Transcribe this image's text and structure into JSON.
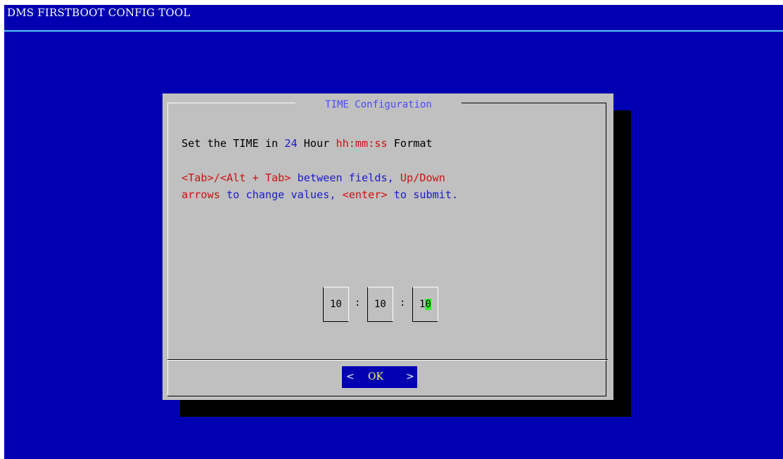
{
  "app": {
    "title": "DMS FIRSTBOOT CONFIG TOOL"
  },
  "dialog": {
    "title": "TIME Configuration",
    "instructions": {
      "line1": [
        "Set the TIME in ",
        "24",
        " Hour ",
        "hh:mm:ss",
        " Format"
      ],
      "line2": [
        "<Tab>/<Alt + Tab>",
        " between fields, ",
        "Up/Down"
      ],
      "line3": [
        "arrows",
        " to change values, ",
        "<enter>",
        " to submit."
      ]
    },
    "time": {
      "hours": "10",
      "minutes": "10",
      "seconds_prefix": "1",
      "seconds_cursor": "0",
      "separator": ":"
    },
    "buttons": {
      "ok_left": "<",
      "ok_label": "OK",
      "ok_right": ">"
    }
  },
  "colors": {
    "screen_background": "#0000b2",
    "dialog_background": "#c0c0c0",
    "title_rule": "#55c8ff",
    "highlight_text": "#d01010",
    "accent_text": "#1a1ad0",
    "cursor_background": "#30ee30",
    "button_label": "#ffff66"
  }
}
